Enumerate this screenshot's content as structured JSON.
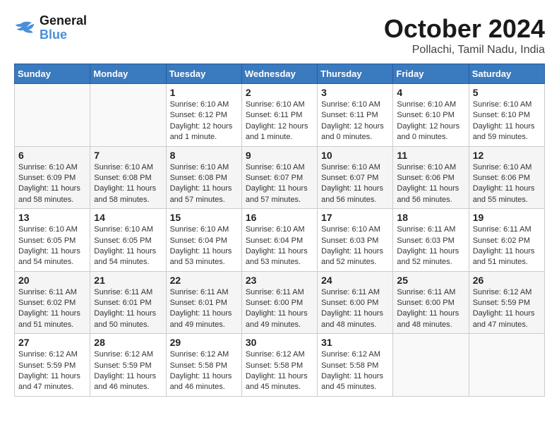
{
  "logo": {
    "text_general": "General",
    "text_blue": "Blue"
  },
  "header": {
    "month": "October 2024",
    "location": "Pollachi, Tamil Nadu, India"
  },
  "weekdays": [
    "Sunday",
    "Monday",
    "Tuesday",
    "Wednesday",
    "Thursday",
    "Friday",
    "Saturday"
  ],
  "weeks": [
    [
      null,
      null,
      {
        "day": "1",
        "sunrise": "Sunrise: 6:10 AM",
        "sunset": "Sunset: 6:12 PM",
        "daylight": "Daylight: 12 hours and 1 minute."
      },
      {
        "day": "2",
        "sunrise": "Sunrise: 6:10 AM",
        "sunset": "Sunset: 6:11 PM",
        "daylight": "Daylight: 12 hours and 1 minute."
      },
      {
        "day": "3",
        "sunrise": "Sunrise: 6:10 AM",
        "sunset": "Sunset: 6:11 PM",
        "daylight": "Daylight: 12 hours and 0 minutes."
      },
      {
        "day": "4",
        "sunrise": "Sunrise: 6:10 AM",
        "sunset": "Sunset: 6:10 PM",
        "daylight": "Daylight: 12 hours and 0 minutes."
      },
      {
        "day": "5",
        "sunrise": "Sunrise: 6:10 AM",
        "sunset": "Sunset: 6:10 PM",
        "daylight": "Daylight: 11 hours and 59 minutes."
      }
    ],
    [
      {
        "day": "6",
        "sunrise": "Sunrise: 6:10 AM",
        "sunset": "Sunset: 6:09 PM",
        "daylight": "Daylight: 11 hours and 58 minutes."
      },
      {
        "day": "7",
        "sunrise": "Sunrise: 6:10 AM",
        "sunset": "Sunset: 6:08 PM",
        "daylight": "Daylight: 11 hours and 58 minutes."
      },
      {
        "day": "8",
        "sunrise": "Sunrise: 6:10 AM",
        "sunset": "Sunset: 6:08 PM",
        "daylight": "Daylight: 11 hours and 57 minutes."
      },
      {
        "day": "9",
        "sunrise": "Sunrise: 6:10 AM",
        "sunset": "Sunset: 6:07 PM",
        "daylight": "Daylight: 11 hours and 57 minutes."
      },
      {
        "day": "10",
        "sunrise": "Sunrise: 6:10 AM",
        "sunset": "Sunset: 6:07 PM",
        "daylight": "Daylight: 11 hours and 56 minutes."
      },
      {
        "day": "11",
        "sunrise": "Sunrise: 6:10 AM",
        "sunset": "Sunset: 6:06 PM",
        "daylight": "Daylight: 11 hours and 56 minutes."
      },
      {
        "day": "12",
        "sunrise": "Sunrise: 6:10 AM",
        "sunset": "Sunset: 6:06 PM",
        "daylight": "Daylight: 11 hours and 55 minutes."
      }
    ],
    [
      {
        "day": "13",
        "sunrise": "Sunrise: 6:10 AM",
        "sunset": "Sunset: 6:05 PM",
        "daylight": "Daylight: 11 hours and 54 minutes."
      },
      {
        "day": "14",
        "sunrise": "Sunrise: 6:10 AM",
        "sunset": "Sunset: 6:05 PM",
        "daylight": "Daylight: 11 hours and 54 minutes."
      },
      {
        "day": "15",
        "sunrise": "Sunrise: 6:10 AM",
        "sunset": "Sunset: 6:04 PM",
        "daylight": "Daylight: 11 hours and 53 minutes."
      },
      {
        "day": "16",
        "sunrise": "Sunrise: 6:10 AM",
        "sunset": "Sunset: 6:04 PM",
        "daylight": "Daylight: 11 hours and 53 minutes."
      },
      {
        "day": "17",
        "sunrise": "Sunrise: 6:10 AM",
        "sunset": "Sunset: 6:03 PM",
        "daylight": "Daylight: 11 hours and 52 minutes."
      },
      {
        "day": "18",
        "sunrise": "Sunrise: 6:11 AM",
        "sunset": "Sunset: 6:03 PM",
        "daylight": "Daylight: 11 hours and 52 minutes."
      },
      {
        "day": "19",
        "sunrise": "Sunrise: 6:11 AM",
        "sunset": "Sunset: 6:02 PM",
        "daylight": "Daylight: 11 hours and 51 minutes."
      }
    ],
    [
      {
        "day": "20",
        "sunrise": "Sunrise: 6:11 AM",
        "sunset": "Sunset: 6:02 PM",
        "daylight": "Daylight: 11 hours and 51 minutes."
      },
      {
        "day": "21",
        "sunrise": "Sunrise: 6:11 AM",
        "sunset": "Sunset: 6:01 PM",
        "daylight": "Daylight: 11 hours and 50 minutes."
      },
      {
        "day": "22",
        "sunrise": "Sunrise: 6:11 AM",
        "sunset": "Sunset: 6:01 PM",
        "daylight": "Daylight: 11 hours and 49 minutes."
      },
      {
        "day": "23",
        "sunrise": "Sunrise: 6:11 AM",
        "sunset": "Sunset: 6:00 PM",
        "daylight": "Daylight: 11 hours and 49 minutes."
      },
      {
        "day": "24",
        "sunrise": "Sunrise: 6:11 AM",
        "sunset": "Sunset: 6:00 PM",
        "daylight": "Daylight: 11 hours and 48 minutes."
      },
      {
        "day": "25",
        "sunrise": "Sunrise: 6:11 AM",
        "sunset": "Sunset: 6:00 PM",
        "daylight": "Daylight: 11 hours and 48 minutes."
      },
      {
        "day": "26",
        "sunrise": "Sunrise: 6:12 AM",
        "sunset": "Sunset: 5:59 PM",
        "daylight": "Daylight: 11 hours and 47 minutes."
      }
    ],
    [
      {
        "day": "27",
        "sunrise": "Sunrise: 6:12 AM",
        "sunset": "Sunset: 5:59 PM",
        "daylight": "Daylight: 11 hours and 47 minutes."
      },
      {
        "day": "28",
        "sunrise": "Sunrise: 6:12 AM",
        "sunset": "Sunset: 5:59 PM",
        "daylight": "Daylight: 11 hours and 46 minutes."
      },
      {
        "day": "29",
        "sunrise": "Sunrise: 6:12 AM",
        "sunset": "Sunset: 5:58 PM",
        "daylight": "Daylight: 11 hours and 46 minutes."
      },
      {
        "day": "30",
        "sunrise": "Sunrise: 6:12 AM",
        "sunset": "Sunset: 5:58 PM",
        "daylight": "Daylight: 11 hours and 45 minutes."
      },
      {
        "day": "31",
        "sunrise": "Sunrise: 6:12 AM",
        "sunset": "Sunset: 5:58 PM",
        "daylight": "Daylight: 11 hours and 45 minutes."
      },
      null,
      null
    ]
  ]
}
